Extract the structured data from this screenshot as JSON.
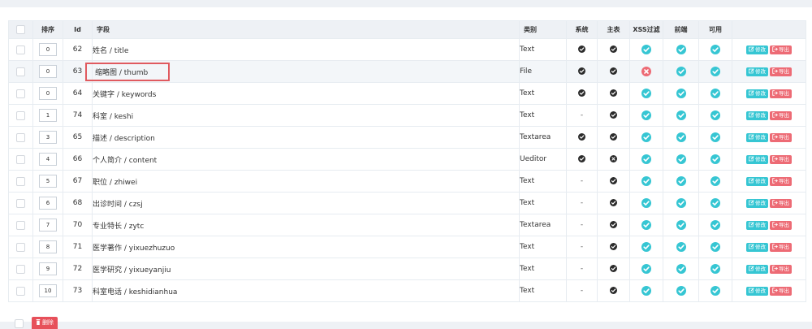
{
  "colors": {
    "accent": "#36c6d3",
    "danger": "#ed6b75",
    "dark": "#2b2b2b"
  },
  "table": {
    "headers": {
      "order": "排序",
      "id": "Id",
      "field": "字段",
      "type": "类别",
      "system": "系统",
      "main": "主表",
      "xss": "XSS过滤",
      "frontend": "前端",
      "enabled": "可用"
    },
    "rows": [
      {
        "order": "0",
        "id": "62",
        "field": "姓名 / title",
        "type": "Text",
        "system": "check",
        "main": "check",
        "xss": "ok",
        "frontend": "ok",
        "enabled": "ok"
      },
      {
        "order": "0",
        "id": "63",
        "field": "缩略图 / thumb",
        "type": "File",
        "system": "check",
        "main": "check",
        "xss": "no",
        "frontend": "ok",
        "enabled": "ok"
      },
      {
        "order": "0",
        "id": "64",
        "field": "关键字 / keywords",
        "type": "Text",
        "system": "check",
        "main": "check",
        "xss": "ok",
        "frontend": "ok",
        "enabled": "ok"
      },
      {
        "order": "1",
        "id": "74",
        "field": "科室 / keshi",
        "type": "Text",
        "system": "-",
        "main": "check",
        "xss": "ok",
        "frontend": "ok",
        "enabled": "ok"
      },
      {
        "order": "3",
        "id": "65",
        "field": "描述 / description",
        "type": "Textarea",
        "system": "check",
        "main": "check",
        "xss": "ok",
        "frontend": "ok",
        "enabled": "ok"
      },
      {
        "order": "4",
        "id": "66",
        "field": "个人简介 / content",
        "type": "Ueditor",
        "system": "check",
        "main": "cross",
        "xss": "ok",
        "frontend": "ok",
        "enabled": "ok"
      },
      {
        "order": "5",
        "id": "67",
        "field": "职位 / zhiwei",
        "type": "Text",
        "system": "-",
        "main": "check",
        "xss": "ok",
        "frontend": "ok",
        "enabled": "ok"
      },
      {
        "order": "6",
        "id": "68",
        "field": "出诊时间 / czsj",
        "type": "Text",
        "system": "-",
        "main": "check",
        "xss": "ok",
        "frontend": "ok",
        "enabled": "ok"
      },
      {
        "order": "7",
        "id": "70",
        "field": "专业特长 / zytc",
        "type": "Textarea",
        "system": "-",
        "main": "check",
        "xss": "ok",
        "frontend": "ok",
        "enabled": "ok"
      },
      {
        "order": "8",
        "id": "71",
        "field": "医学著作 / yixuezhuzuo",
        "type": "Text",
        "system": "-",
        "main": "check",
        "xss": "ok",
        "frontend": "ok",
        "enabled": "ok"
      },
      {
        "order": "9",
        "id": "72",
        "field": "医学研究 / yixueyanjiu",
        "type": "Text",
        "system": "-",
        "main": "check",
        "xss": "ok",
        "frontend": "ok",
        "enabled": "ok"
      },
      {
        "order": "10",
        "id": "73",
        "field": "科室电话 / keshidianhua",
        "type": "Text",
        "system": "-",
        "main": "check",
        "xss": "ok",
        "frontend": "ok",
        "enabled": "ok"
      }
    ],
    "highlight_row": 1
  },
  "actions": {
    "edit_label": "修改",
    "export_label": "导出"
  },
  "footer": {
    "delete_label": "删除"
  }
}
